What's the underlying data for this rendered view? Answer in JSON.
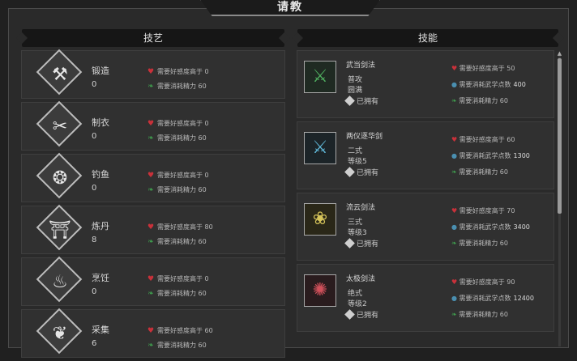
{
  "title": "请教",
  "left_header": "技艺",
  "right_header": "技能",
  "colors": {
    "heart": "#c9313a",
    "leaf": "#3f9e4e",
    "drop": "#4a8fb0"
  },
  "crafts": [
    {
      "name": "锻造",
      "value": "0",
      "icon": "forging-icon",
      "req_affection": "需要好感度高于 0",
      "req_energy": "需要消耗精力 60"
    },
    {
      "name": "制衣",
      "value": "0",
      "icon": "tailoring-icon",
      "req_affection": "需要好感度高于 0",
      "req_energy": "需要消耗精力 60"
    },
    {
      "name": "钓鱼",
      "value": "0",
      "icon": "fishing-icon",
      "req_affection": "需要好感度高于 0",
      "req_energy": "需要消耗精力 60"
    },
    {
      "name": "炼丹",
      "value": "8",
      "icon": "alchemy-icon",
      "req_affection": "需要好感度高于 80",
      "req_energy": "需要消耗精力 60"
    },
    {
      "name": "烹饪",
      "value": "0",
      "icon": "cooking-icon",
      "req_affection": "需要好感度高于 0",
      "req_energy": "需要消耗精力 60"
    },
    {
      "name": "采集",
      "value": "6",
      "icon": "gathering-icon",
      "req_affection": "需要好感度高于 60",
      "req_energy": "需要消耗精力 60"
    }
  ],
  "skills": [
    {
      "name": "武当剑法",
      "line1": "普攻",
      "line2": "圆满",
      "owned": "已拥有",
      "icon": "wudang-sword-icon",
      "color": "#4fae5f",
      "req_affection": "需要好感度高于 50",
      "req_points_label": "需要消耗武学点数",
      "req_points": "400",
      "req_energy": "需要消耗精力 60"
    },
    {
      "name": "两仪逐华剑",
      "line1": "二式",
      "line2": "等级5",
      "owned": "已拥有",
      "icon": "liangyi-sword-icon",
      "color": "#5fb6d6",
      "req_affection": "需要好感度高于 60",
      "req_points_label": "需要消耗武学点数",
      "req_points": "1300",
      "req_energy": "需要消耗精力 60"
    },
    {
      "name": "流云剑法",
      "line1": "三式",
      "line2": "等级3",
      "owned": "已拥有",
      "icon": "liuyun-sword-icon",
      "color": "#d6c45a",
      "req_affection": "需要好感度高于 70",
      "req_points_label": "需要消耗武学点数",
      "req_points": "3400",
      "req_energy": "需要消耗精力 60"
    },
    {
      "name": "太极剑法",
      "line1": "绝式",
      "line2": "等级2",
      "owned": "已拥有",
      "icon": "taiji-sword-icon",
      "color": "#d0505a",
      "req_affection": "需要好感度高于 90",
      "req_points_label": "需要消耗武学点数",
      "req_points": "12400",
      "req_energy": "需要消耗精力 60"
    }
  ]
}
